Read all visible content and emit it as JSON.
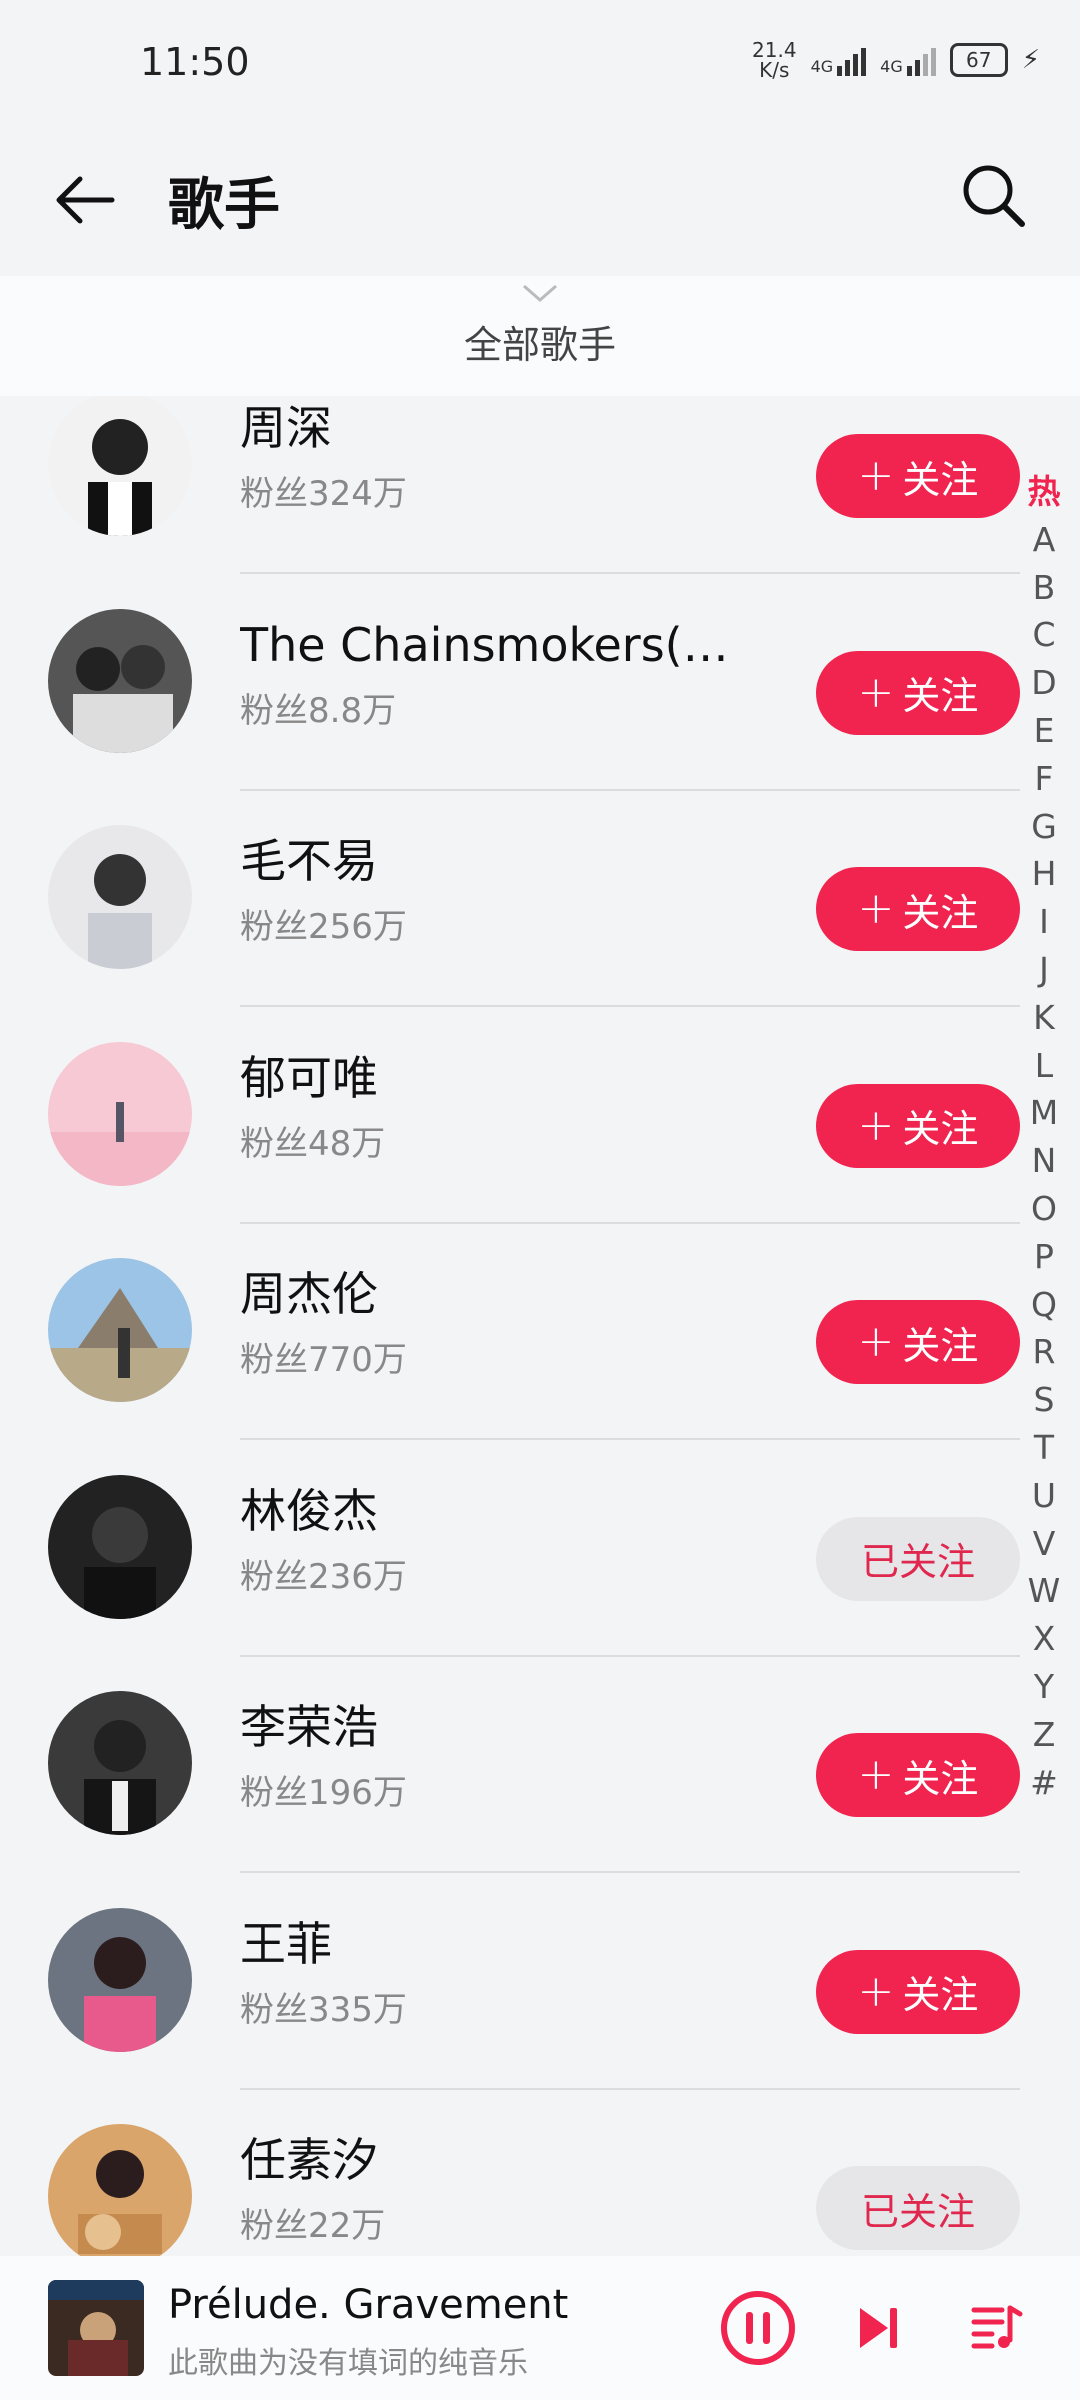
{
  "status": {
    "time": "11:50",
    "net_speed_top": "21.4",
    "net_speed_bottom": "K/s",
    "sim1": "4G",
    "sim2": "4G",
    "battery": "67"
  },
  "header": {
    "title": "歌手"
  },
  "filter": {
    "label": "全部歌手"
  },
  "follow_label": "关注",
  "followed_label": "已关注",
  "artists": [
    {
      "name": "周深",
      "fans": "粉丝324万",
      "followed": false
    },
    {
      "name": "The Chainsmokers(烟...",
      "fans": "粉丝8.8万",
      "followed": false
    },
    {
      "name": "毛不易",
      "fans": "粉丝256万",
      "followed": false
    },
    {
      "name": "郁可唯",
      "fans": "粉丝48万",
      "followed": false
    },
    {
      "name": "周杰伦",
      "fans": "粉丝770万",
      "followed": false
    },
    {
      "name": "林俊杰",
      "fans": "粉丝236万",
      "followed": true
    },
    {
      "name": "李荣浩",
      "fans": "粉丝196万",
      "followed": false
    },
    {
      "name": "王菲",
      "fans": "粉丝335万",
      "followed": false
    },
    {
      "name": "任素汐",
      "fans": "粉丝22万",
      "followed": true
    }
  ],
  "index": [
    "热",
    "A",
    "B",
    "C",
    "D",
    "E",
    "F",
    "G",
    "H",
    "I",
    "J",
    "K",
    "L",
    "M",
    "N",
    "O",
    "P",
    "Q",
    "R",
    "S",
    "T",
    "U",
    "V",
    "W",
    "X",
    "Y",
    "Z",
    "#"
  ],
  "player": {
    "song": "Prélude. Gravement",
    "desc": "此歌曲为没有填词的纯音乐",
    "state": "playing"
  },
  "colors": {
    "accent": "#f0244f",
    "background": "#f3f4f6"
  }
}
